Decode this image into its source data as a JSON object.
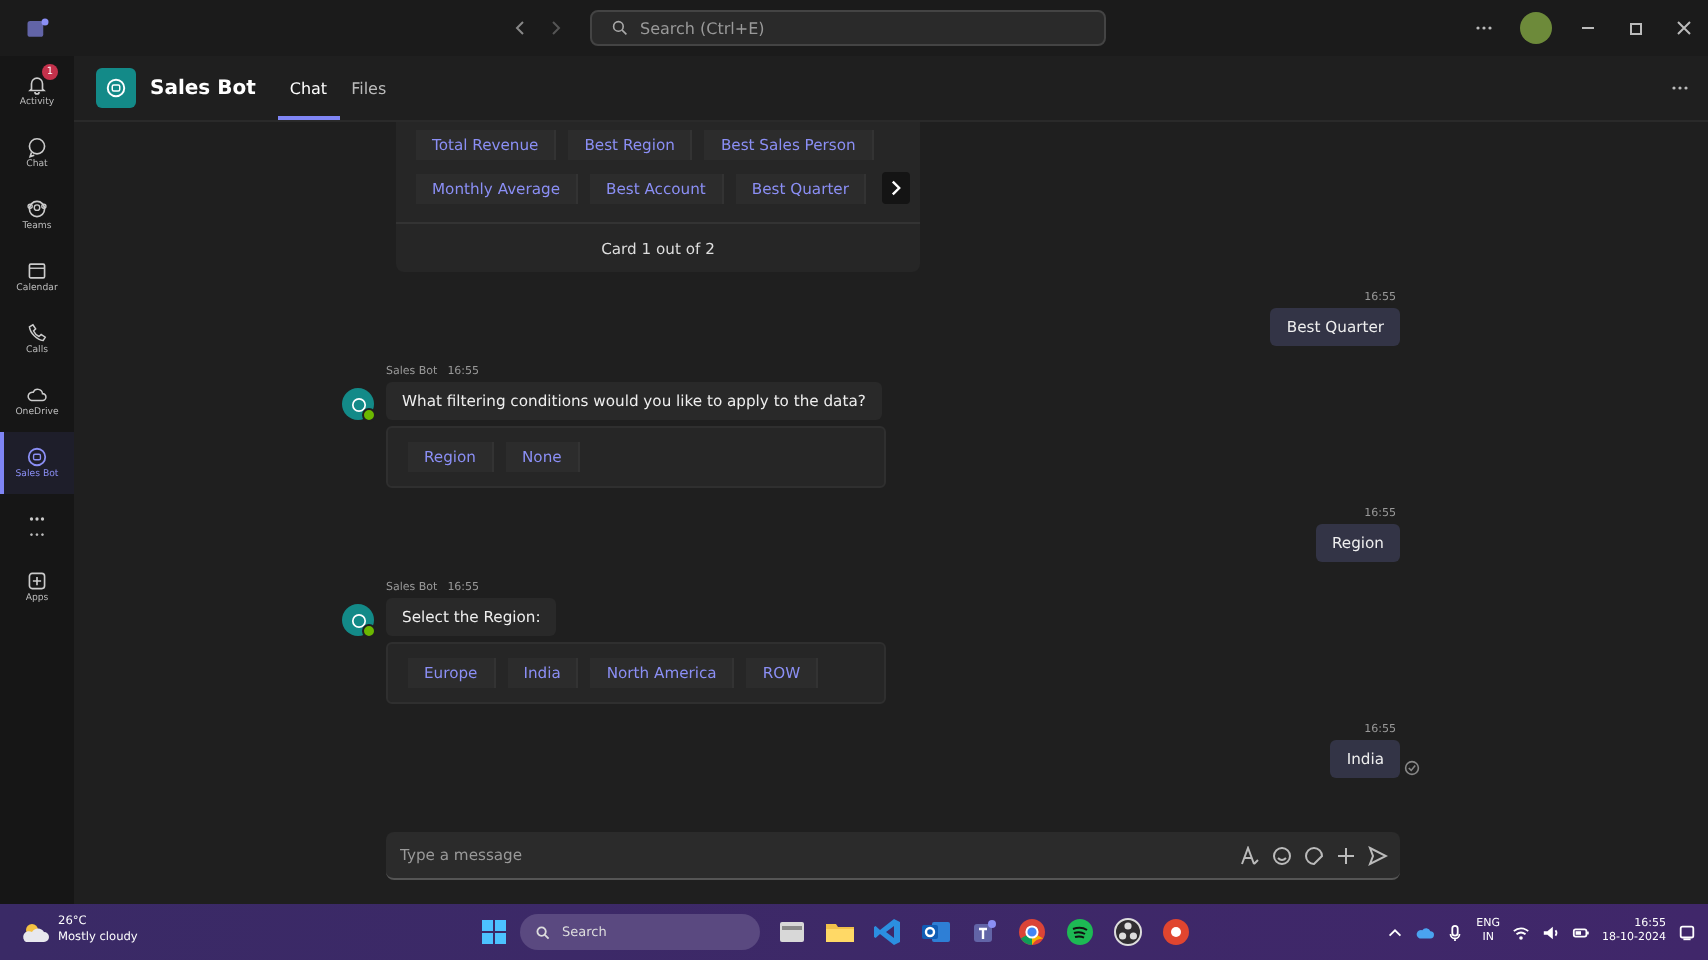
{
  "titlebar": {
    "search": {
      "placeholder": "Search (Ctrl+E)"
    }
  },
  "rail": [
    {
      "label": "Activity",
      "badge": "1",
      "selected": false
    },
    {
      "label": "Chat",
      "selected": false
    },
    {
      "label": "Teams",
      "selected": false
    },
    {
      "label": "Calendar",
      "selected": false
    },
    {
      "label": "Calls",
      "selected": false
    },
    {
      "label": "OneDrive",
      "selected": false
    },
    {
      "label": "Sales Bot",
      "selected": true
    },
    {
      "label": "•••",
      "selected": false
    },
    {
      "label": "Apps",
      "selected": false
    }
  ],
  "header": {
    "title": "Sales Bot",
    "tabs": [
      {
        "label": "Chat",
        "selected": true
      },
      {
        "label": "Files",
        "selected": false
      }
    ]
  },
  "messages": [
    {
      "kind": "card",
      "rows": [
        [
          "Total Revenue",
          "Best Region",
          "Best Sales Person"
        ],
        [
          "Monthly Average",
          "Best Account",
          "Best Quarter"
        ]
      ],
      "footer": "Card 1 out of 2"
    },
    {
      "kind": "user",
      "time": "16:55",
      "text": "Best Quarter"
    },
    {
      "kind": "bot",
      "sender": "Sales Bot",
      "time": "16:55",
      "text": "What filtering conditions would you like to apply to the data?",
      "buttons": [
        "Region",
        "None"
      ]
    },
    {
      "kind": "user",
      "time": "16:55",
      "text": "Region"
    },
    {
      "kind": "bot",
      "sender": "Sales Bot",
      "time": "16:55",
      "text": "Select the Region:",
      "buttons": [
        "Europe",
        "India",
        "North America",
        "ROW"
      ]
    },
    {
      "kind": "user",
      "time": "16:55",
      "text": "India",
      "seen": true
    }
  ],
  "compose": {
    "placeholder": "Type a message"
  },
  "taskbar": {
    "temperature": "26°C",
    "weather": "Mostly cloudy",
    "search": "Search",
    "lang": "ENG",
    "region": "IN",
    "time": "16:55",
    "date": "18-10-2024"
  }
}
